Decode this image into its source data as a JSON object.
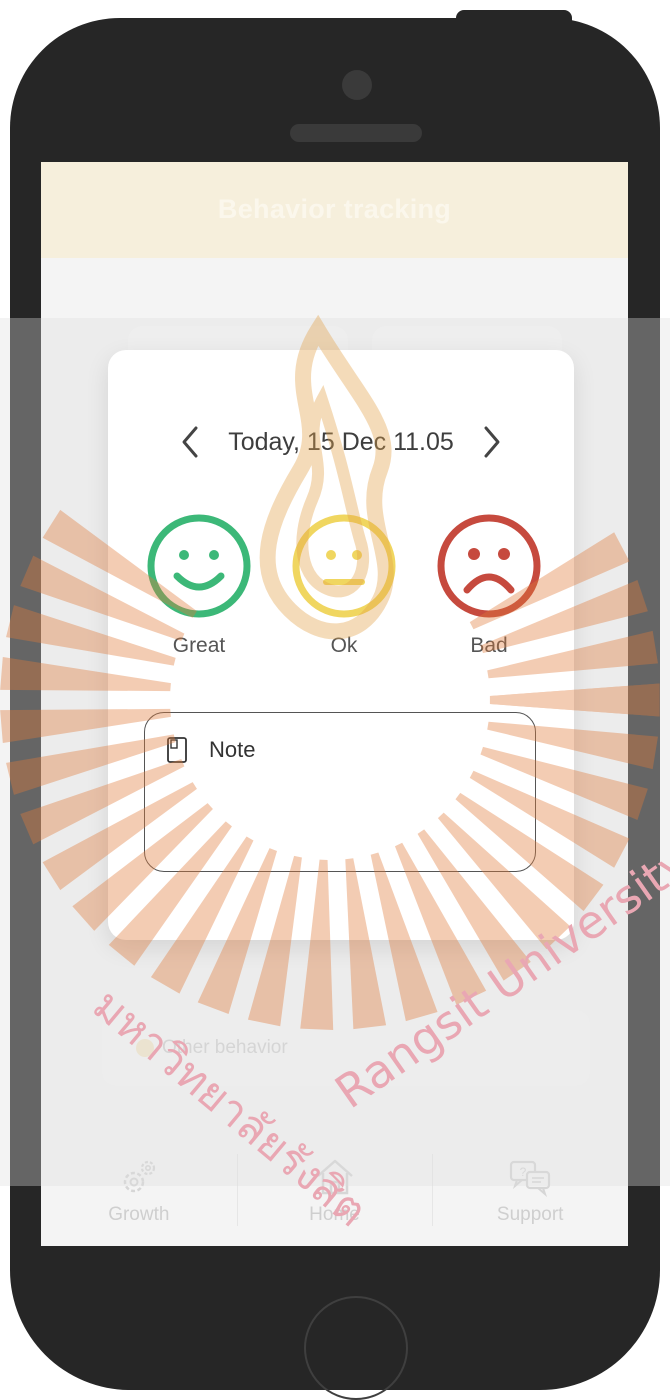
{
  "header": {
    "title": "Behavior tracking"
  },
  "modal": {
    "date_label": "Today, 15 Dec 11.05",
    "moods": [
      {
        "label": "Great",
        "color": "#3cb878",
        "icon": "happy-face-icon"
      },
      {
        "label": "Ok",
        "color": "#f0d660",
        "icon": "neutral-face-icon"
      },
      {
        "label": "Bad",
        "color": "#c64a3e",
        "icon": "sad-face-icon"
      }
    ],
    "note_label": "Note"
  },
  "background": {
    "other_behavior_label": "Other behavior"
  },
  "tabs": [
    {
      "label": "Growth",
      "icon": "gears-icon"
    },
    {
      "label": "Home",
      "icon": "house-icon"
    },
    {
      "label": "Support",
      "icon": "chat-bubbles-icon"
    }
  ],
  "watermark": {
    "thai_text": "มหาวิทยาลัยรังสิต",
    "latin_text": "Rangsit University"
  }
}
